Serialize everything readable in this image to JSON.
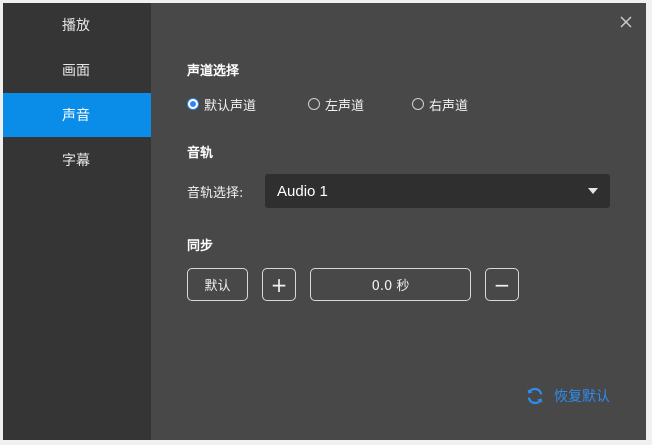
{
  "sidebar": {
    "items": [
      {
        "label": "播放"
      },
      {
        "label": "画面"
      },
      {
        "label": "声音"
      },
      {
        "label": "字幕"
      }
    ],
    "active_index": 2
  },
  "colors": {
    "accent": "#0a8de8",
    "link": "#2d8cf0",
    "panel": "#484848",
    "sidebar": "#353535"
  },
  "icons": {
    "close": "close-icon",
    "restore": "refresh-icon",
    "dropdown": "caret-down-icon"
  },
  "channel": {
    "title": "声道选择",
    "options": [
      {
        "label": "默认声道",
        "checked": true
      },
      {
        "label": "左声道",
        "checked": false
      },
      {
        "label": "右声道",
        "checked": false
      }
    ]
  },
  "track": {
    "title": "音轨",
    "select_label": "音轨选择:",
    "selected": "Audio 1"
  },
  "sync": {
    "title": "同步",
    "default_label": "默认",
    "plus_label": "+",
    "value": "0.0 秒",
    "minus_label": "−"
  },
  "footer": {
    "restore_label": "恢复默认"
  }
}
